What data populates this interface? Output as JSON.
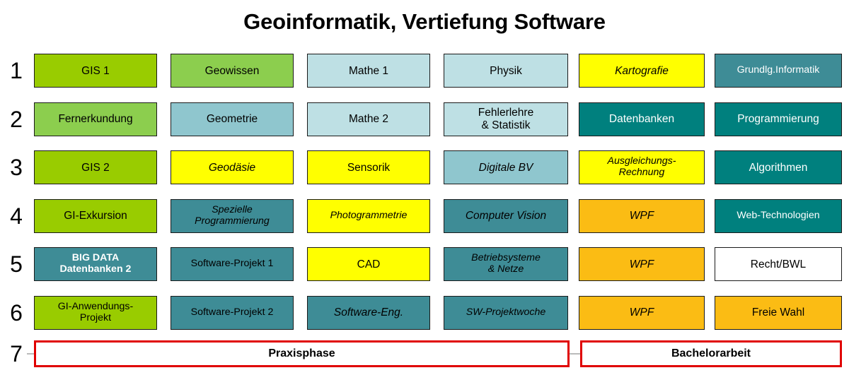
{
  "title": "Geoinformatik, Vertiefung Software",
  "colors": {
    "bright_green": "#99CC00",
    "light_green": "#8CCE4E",
    "light_blue": "#BEE0E4",
    "mid_blue": "#8FC6CE",
    "mid_teal": "#3E8C96",
    "dark_teal": "#00807E",
    "yellow": "#FFFF00",
    "orange": "#FBBC14",
    "white": "#FFFFFF",
    "phase_border": "#E00000"
  },
  "semesters": [
    "1",
    "2",
    "3",
    "4",
    "5",
    "6",
    "7"
  ],
  "rows": [
    {
      "number": "1",
      "cells": [
        {
          "label": "GIS 1",
          "bg": "#99CC00",
          "fg": "#000000",
          "italic": false,
          "bold": false
        },
        {
          "label": "Geowissen",
          "bg": "#8CCE4E",
          "fg": "#000000",
          "italic": false,
          "bold": false
        },
        {
          "label": "Mathe 1",
          "bg": "#BEE0E4",
          "fg": "#000000",
          "italic": false,
          "bold": false
        },
        {
          "label": "Physik",
          "bg": "#BEE0E4",
          "fg": "#000000",
          "italic": false,
          "bold": false
        },
        {
          "label": "Kartografie",
          "bg": "#FFFF00",
          "fg": "#000000",
          "italic": true,
          "bold": false
        },
        {
          "label": "Grundlg.Informatik",
          "bg": "#3E8C96",
          "fg": "#FFFFFF",
          "italic": false,
          "bold": false,
          "size": "small"
        }
      ]
    },
    {
      "number": "2",
      "cells": [
        {
          "label": "Fernerkundung",
          "bg": "#8CCE4E",
          "fg": "#000000",
          "italic": false,
          "bold": false
        },
        {
          "label": "Geometrie",
          "bg": "#8FC6CE",
          "fg": "#000000",
          "italic": false,
          "bold": false
        },
        {
          "label": "Mathe 2",
          "bg": "#BEE0E4",
          "fg": "#000000",
          "italic": false,
          "bold": false
        },
        {
          "label": "Fehlerlehre\n& Statistik",
          "bg": "#BEE0E4",
          "fg": "#000000",
          "italic": false,
          "bold": false
        },
        {
          "label": "Datenbanken",
          "bg": "#00807E",
          "fg": "#FFFFFF",
          "italic": false,
          "bold": false
        },
        {
          "label": "Programmierung",
          "bg": "#00807E",
          "fg": "#FFFFFF",
          "italic": false,
          "bold": false
        }
      ]
    },
    {
      "number": "3",
      "cells": [
        {
          "label": "GIS 2",
          "bg": "#99CC00",
          "fg": "#000000",
          "italic": false,
          "bold": false
        },
        {
          "label": "Geodäsie",
          "bg": "#FFFF00",
          "fg": "#000000",
          "italic": true,
          "bold": false
        },
        {
          "label": "Sensorik",
          "bg": "#FFFF00",
          "fg": "#000000",
          "italic": false,
          "bold": false
        },
        {
          "label": "Digitale BV",
          "bg": "#8FC6CE",
          "fg": "#000000",
          "italic": true,
          "bold": false
        },
        {
          "label": "Ausgleichungs-\nRechnung",
          "bg": "#FFFF00",
          "fg": "#000000",
          "italic": true,
          "bold": false,
          "size": "small"
        },
        {
          "label": "Algorithmen",
          "bg": "#00807E",
          "fg": "#FFFFFF",
          "italic": false,
          "bold": false
        }
      ]
    },
    {
      "number": "4",
      "cells": [
        {
          "label": "GI-Exkursion",
          "bg": "#99CC00",
          "fg": "#000000",
          "italic": false,
          "bold": false
        },
        {
          "label": "Spezielle\nProgrammierung",
          "bg": "#3E8C96",
          "fg": "#000000",
          "italic": true,
          "bold": false,
          "size": "small"
        },
        {
          "label": "Photogrammetrie",
          "bg": "#FFFF00",
          "fg": "#000000",
          "italic": true,
          "bold": false,
          "size": "small"
        },
        {
          "label": "Computer Vision",
          "bg": "#3E8C96",
          "fg": "#000000",
          "italic": true,
          "bold": false
        },
        {
          "label": "WPF",
          "bg": "#FBBC14",
          "fg": "#000000",
          "italic": true,
          "bold": false
        },
        {
          "label": "Web-Technologien",
          "bg": "#00807E",
          "fg": "#FFFFFF",
          "italic": false,
          "bold": false,
          "size": "small"
        }
      ]
    },
    {
      "number": "5",
      "cells": [
        {
          "label": "BIG DATA\nDatenbanken 2",
          "bg": "#3E8C96",
          "fg": "#FFFFFF",
          "italic": false,
          "bold": true,
          "size": "small"
        },
        {
          "label": "Software-Projekt 1",
          "bg": "#3E8C96",
          "fg": "#000000",
          "italic": false,
          "bold": false,
          "size": "small"
        },
        {
          "label": "CAD",
          "bg": "#FFFF00",
          "fg": "#000000",
          "italic": false,
          "bold": false
        },
        {
          "label": "Betriebsysteme\n& Netze",
          "bg": "#3E8C96",
          "fg": "#000000",
          "italic": true,
          "bold": false,
          "size": "small"
        },
        {
          "label": "WPF",
          "bg": "#FBBC14",
          "fg": "#000000",
          "italic": true,
          "bold": false
        },
        {
          "label": "Recht/BWL",
          "bg": "#FFFFFF",
          "fg": "#000000",
          "italic": false,
          "bold": false
        }
      ]
    },
    {
      "number": "6",
      "cells": [
        {
          "label": "GI-Anwendungs-\nProjekt",
          "bg": "#99CC00",
          "fg": "#000000",
          "italic": false,
          "bold": false,
          "size": "small"
        },
        {
          "label": "Software-Projekt 2",
          "bg": "#3E8C96",
          "fg": "#000000",
          "italic": false,
          "bold": false,
          "size": "small"
        },
        {
          "label": "Software-Eng.",
          "bg": "#3E8C96",
          "fg": "#000000",
          "italic": true,
          "bold": false
        },
        {
          "label": "SW-Projektwoche",
          "bg": "#3E8C96",
          "fg": "#000000",
          "italic": true,
          "bold": false,
          "size": "small"
        },
        {
          "label": "WPF",
          "bg": "#FBBC14",
          "fg": "#000000",
          "italic": true,
          "bold": false
        },
        {
          "label": "Freie Wahl",
          "bg": "#FBBC14",
          "fg": "#000000",
          "italic": false,
          "bold": false
        }
      ]
    }
  ],
  "final_row": {
    "number": "7",
    "left": {
      "label": "Praxisphase"
    },
    "right": {
      "label": "Bachelorarbeit"
    }
  }
}
